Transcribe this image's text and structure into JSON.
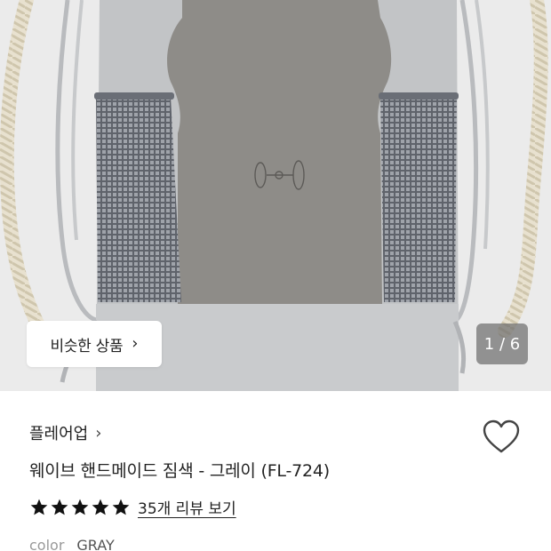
{
  "gallery": {
    "similar_products_label": "비슷한 상품",
    "chevron": "›",
    "current_page": "1",
    "total_pages": "6",
    "page_counter": "1 / 6"
  },
  "product": {
    "brand": "플레어업",
    "brand_chevron": "›",
    "title": "웨이브 핸드메이드 짐색 - 그레이 (FL-724)",
    "rating_stars": 5,
    "review_link": "35개 리뷰 보기",
    "color_label": "color",
    "color_value": "GRAY"
  },
  "icons": {
    "wishlist": "heart-icon",
    "star": "star-icon",
    "next": "chevron-right-icon"
  },
  "colors": {
    "image_background": "#ebebeb",
    "bag_light_gray": "#c2c4c6",
    "bag_dark_gray": "#8e8c88",
    "mesh": "#6f737b",
    "text": "#222222",
    "muted": "#999999"
  }
}
